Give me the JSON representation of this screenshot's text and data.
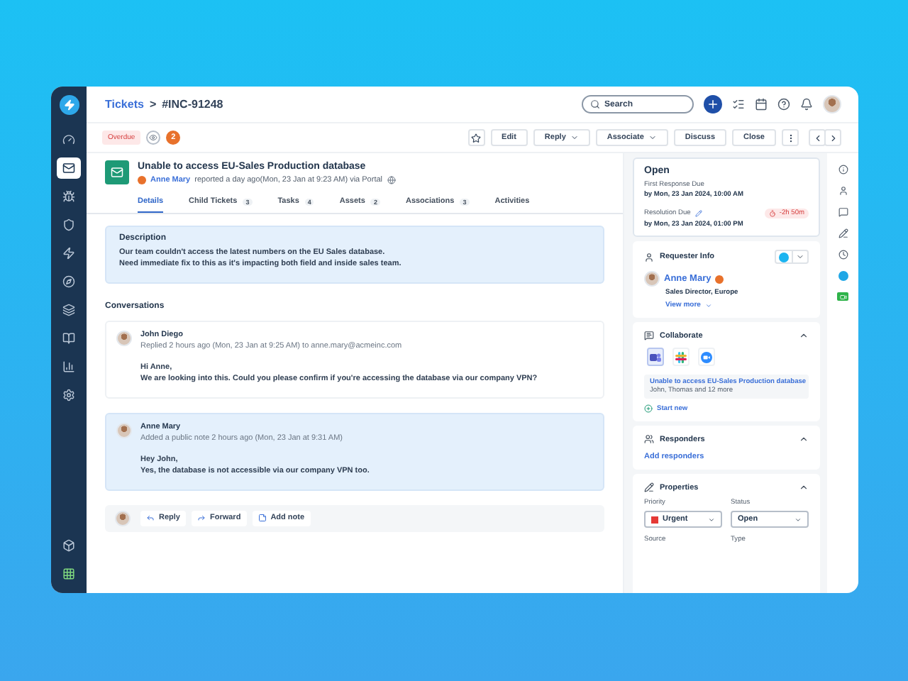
{
  "breadcrumb": {
    "parent": "Tickets",
    "separator": ">",
    "current": "#INC-91248"
  },
  "search": {
    "placeholder": "Search"
  },
  "nav_items": [
    {
      "kind": "gauge",
      "selected": false
    },
    {
      "kind": "ticket",
      "selected": true
    },
    {
      "kind": "bug",
      "selected": false
    },
    {
      "kind": "shield",
      "selected": false
    },
    {
      "kind": "bolt",
      "selected": false
    },
    {
      "kind": "compass",
      "selected": false
    },
    {
      "kind": "layers",
      "selected": false
    },
    {
      "kind": "book",
      "selected": false
    },
    {
      "kind": "chart",
      "selected": false
    },
    {
      "kind": "gear",
      "selected": false
    }
  ],
  "ticket": {
    "status_badge": "Overdue",
    "watchers": "2",
    "title": "Unable to access EU-Sales Production database",
    "requester": "Anne Mary",
    "meta": "reported a day ago(Mon, 23 Jan at 9:23 AM) via Portal"
  },
  "actions": [
    {
      "label": "Edit",
      "dropdown": false
    },
    {
      "label": "Reply",
      "dropdown": true
    },
    {
      "label": "Associate",
      "dropdown": true
    },
    {
      "label": "Discuss",
      "dropdown": false
    },
    {
      "label": "Close",
      "dropdown": false
    }
  ],
  "tabs": [
    {
      "label": "Details",
      "selected": true
    },
    {
      "label": "Child Tickets",
      "count": "3",
      "selected": false
    },
    {
      "label": "Tasks",
      "count": "4",
      "selected": false
    },
    {
      "label": "Assets",
      "count": "2",
      "selected": false
    },
    {
      "label": "Associations",
      "count": "3",
      "selected": false
    },
    {
      "label": "Activities",
      "selected": false
    }
  ],
  "description": {
    "title": "Description",
    "lines": [
      "Our team couldn't access the latest numbers on the EU Sales database.",
      "Need immediate fix to this as it's impacting both field and inside sales team."
    ]
  },
  "conversations": {
    "title": "Conversations",
    "items": [
      {
        "kind": "reply",
        "author": "John Diego",
        "meta": "Replied 2 hours ago (Mon, 23 Jan at 9:25 AM) to anne.mary@acmeinc.com",
        "lines": [
          "Hi Anne,",
          "We are looking into this. Could you please confirm if you're accessing the database via our company VPN?"
        ]
      },
      {
        "kind": "note",
        "author": "Anne Mary",
        "meta": "Added a public note 2 hours ago (Mon, 23 Jan at 9:31 AM)",
        "lines": [
          "Hey John,",
          "Yes, the database is not accessible via our company VPN too."
        ]
      }
    ]
  },
  "composer": [
    {
      "kind": "reply",
      "label": "Reply"
    },
    {
      "kind": "forward",
      "label": "Forward"
    },
    {
      "kind": "note",
      "label": "Add note"
    }
  ],
  "sla": {
    "status": "Open",
    "first_response_label": "First Response Due",
    "first_response": "by Mon, 23 Jan 2024, 10:00 AM",
    "resolution_label": "Resolution Due",
    "resolution": "by Mon, 23 Jan 2024, 01:00 PM",
    "timer": "-2h 50m"
  },
  "requester": {
    "title": "Requester Info",
    "name": "Anne Mary",
    "role": "Sales Director, Europe",
    "link": "View more"
  },
  "collaborate": {
    "title": "Collaborate",
    "expanded": true,
    "apps": [
      {
        "kind": "teams",
        "selected": true
      },
      {
        "kind": "slack",
        "selected": false
      },
      {
        "kind": "zoom",
        "selected": false
      }
    ],
    "thread_title": "Unable to access EU-Sales Production database",
    "thread_people": "John, Thomas and 12 more",
    "start": "Start new"
  },
  "responders": {
    "title": "Responders",
    "expanded": true,
    "link": "Add responders"
  },
  "properties": {
    "title": "Properties",
    "expanded": true,
    "fields": [
      {
        "label": "Priority",
        "value": "Urgent",
        "color": "#e53935"
      },
      {
        "label": "Status",
        "value": "Open"
      }
    ],
    "more_labels": [
      "Source",
      "Type"
    ]
  }
}
